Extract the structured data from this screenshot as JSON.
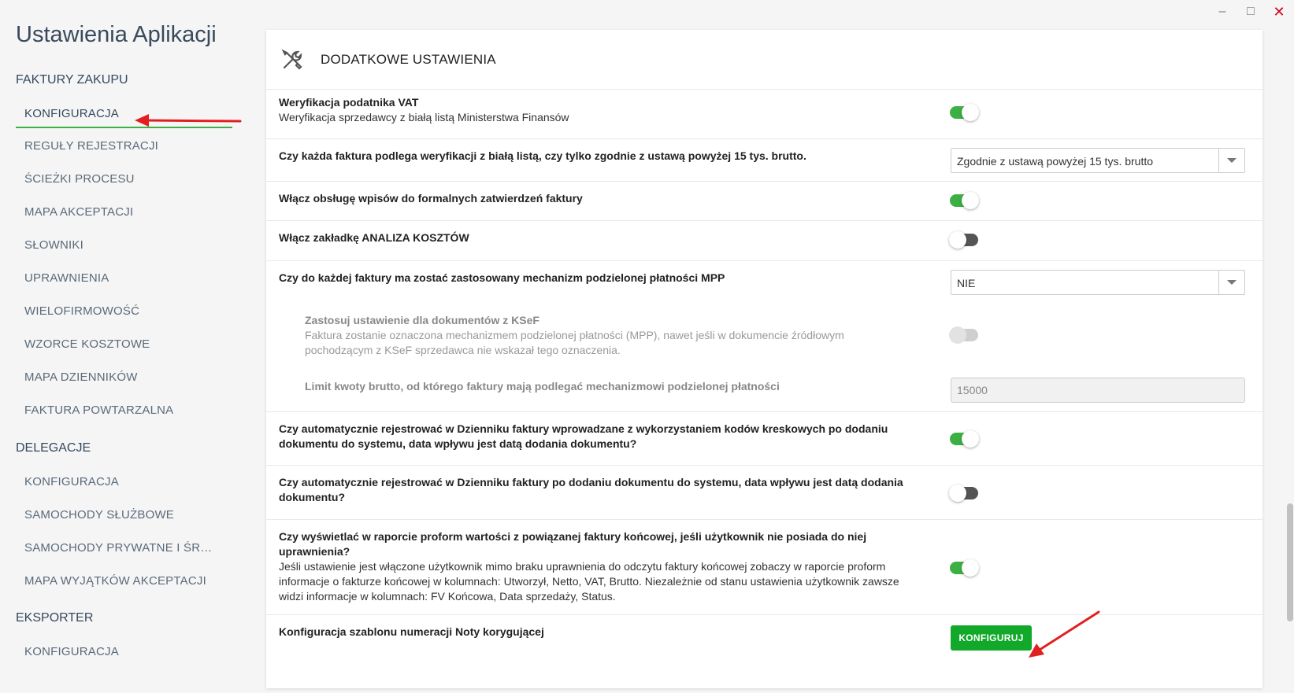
{
  "window": {
    "minimize": "–",
    "maximize": "□",
    "close": "✕"
  },
  "sidebar": {
    "title": "Ustawienia Aplikacji",
    "sections": [
      {
        "title": "FAKTURY ZAKUPU",
        "items": [
          "KONFIGURACJA",
          "REGUŁY REJESTRACJI",
          "ŚCIEŻKI PROCESU",
          "MAPA AKCEPTACJI",
          "SŁOWNIKI",
          "UPRAWNIENIA",
          "WIELOFIRMOWOŚĆ",
          "WZORCE KOSZTOWE",
          "MAPA DZIENNIKÓW",
          "FAKTURA POWTARZALNA"
        ]
      },
      {
        "title": "DELEGACJE",
        "items": [
          "KONFIGURACJA",
          "SAMOCHODY SŁUŻBOWE",
          "SAMOCHODY PRYWATNE I ŚROD...",
          "MAPA WYJĄTKÓW AKCEPTACJI"
        ]
      },
      {
        "title": "EKSPORTER",
        "items": [
          "KONFIGURACJA"
        ]
      }
    ],
    "active_item": "KONFIGURACJA"
  },
  "panel": {
    "icon": "tools-icon",
    "title": "DODATKOWE USTAWIENIA",
    "settings": [
      {
        "label": "Weryfikacja podatnika VAT",
        "description": "Weryfikacja sprzedawcy z białą listą Ministerstwa Finansów",
        "control": "toggle",
        "state": "on"
      },
      {
        "label": "Czy każda faktura podlega weryfikacji z białą listą, czy tylko zgodnie z ustawą powyżej 15 tys. brutto.",
        "control": "select",
        "value": "Zgodnie z ustawą powyżej 15 tys. brutto"
      },
      {
        "label": "Włącz obsługę wpisów do formalnych zatwierdzeń faktury",
        "control": "toggle",
        "state": "on"
      },
      {
        "label": "Włącz zakładkę ANALIZA KOSZTÓW",
        "control": "toggle",
        "state": "off"
      },
      {
        "label": "Czy do każdej faktury ma zostać zastosowany mechanizm podzielonej płatności MPP",
        "control": "select",
        "value": "NIE"
      },
      {
        "label": "Zastosuj ustawienie dla dokumentów z KSeF",
        "description": "Faktura zostanie oznaczona mechanizmem podzielonej płatności (MPP), nawet jeśli w dokumencie źródłowym pochodzącym z KSeF sprzedawca nie wskazał tego oznaczenia.",
        "control": "toggle",
        "state": "disabled"
      },
      {
        "label": "Limit kwoty brutto, od którego faktury mają podlegać mechanizmowi podzielonej płatności",
        "control": "input",
        "value": "15000"
      },
      {
        "label": "Czy automatycznie rejestrować w Dzienniku faktury wprowadzane z wykorzystaniem kodów kreskowych po dodaniu dokumentu do systemu, data wpływu jest datą dodania dokumentu?",
        "control": "toggle",
        "state": "on"
      },
      {
        "label": "Czy automatycznie rejestrować w Dzienniku faktury po dodaniu dokumentu do systemu, data wpływu jest datą dodania dokumentu?",
        "control": "toggle",
        "state": "off"
      },
      {
        "label": "Czy wyświetlać w raporcie proform wartości z powiązanej faktury końcowej, jeśli użytkownik nie posiada do niej uprawnienia?",
        "description": "Jeśli ustawienie jest włączone użytkownik mimo braku uprawnienia do odczytu faktury końcowej zobaczy w raporcie proform informacje o fakturze końcowej w kolumnach: Utworzył, Netto, VAT, Brutto. Niezależnie od stanu ustawienia użytkownik zawsze widzi informacje w kolumnach: FV Końcowa, Data sprzedaży, Status.",
        "control": "toggle",
        "state": "on"
      },
      {
        "label": "Konfiguracja szablonu numeracji Noty korygującej",
        "control": "button",
        "button_label": "KONFIGURUJ"
      }
    ]
  },
  "colors": {
    "accent_green": "#3cb043",
    "button_green": "#12a82a",
    "annotation_red": "#e02020"
  }
}
